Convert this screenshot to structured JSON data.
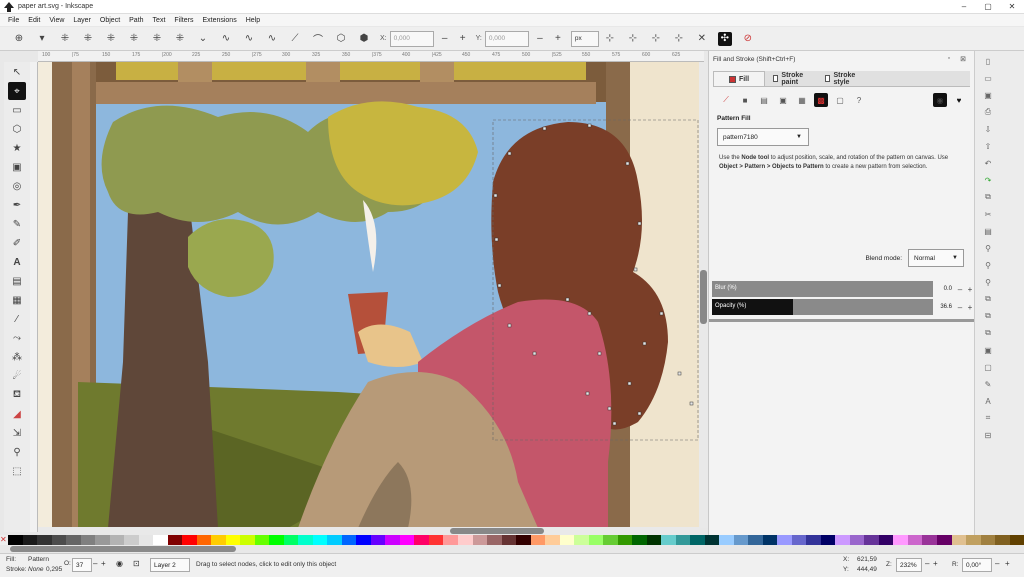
{
  "window": {
    "title": "paper art.svg - Inkscape",
    "controls": [
      "–",
      "▢",
      "✕"
    ]
  },
  "menu": [
    "File",
    "Edit",
    "View",
    "Layer",
    "Object",
    "Path",
    "Text",
    "Filters",
    "Extensions",
    "Help"
  ],
  "tool_controls": {
    "x_label": "X:",
    "x_value": "0,000",
    "y_label": "Y:",
    "y_value": "0,000",
    "unit": "px"
  },
  "ruler_ticks": [
    "100",
    "|75",
    "150",
    "175",
    "|200",
    "225",
    "250",
    "|275",
    "300",
    "325",
    "350",
    "|375",
    "400",
    "|425",
    "450",
    "475",
    "500",
    "|525",
    "550",
    "575",
    "600",
    "625"
  ],
  "dock": {
    "title": "Fill and Stroke (Shift+Ctrl+F)",
    "tabs": [
      "Fill",
      "Stroke paint",
      "Stroke style"
    ],
    "section_title": "Pattern Fill",
    "pattern_value": "pattern7180",
    "help_parts": [
      "Use the ",
      "Node tool",
      " to adjust position, scale, and rotation of the pattern on canvas. Use ",
      "Object > Pattern > Objects to Pattern",
      " to create a new pattern from selection."
    ],
    "blend_label": "Blend mode:",
    "blend_value": "Normal",
    "blur_label": "Blur (%)",
    "blur_value": "0.0",
    "blur_fraction": 0.0,
    "opacity_label": "Opacity (%)",
    "opacity_value": "36.6",
    "opacity_fraction": 0.366
  },
  "palette_colors": [
    "#000000",
    "#1a1a1a",
    "#333333",
    "#4d4d4d",
    "#666666",
    "#808080",
    "#999999",
    "#b3b3b3",
    "#cccccc",
    "#e6e6e6",
    "#ffffff",
    "#800000",
    "#ff0000",
    "#ff6600",
    "#ffcc00",
    "#ffff00",
    "#ccff00",
    "#66ff00",
    "#00ff00",
    "#00ff66",
    "#00ffcc",
    "#00ffff",
    "#00ccff",
    "#0066ff",
    "#0000ff",
    "#6600ff",
    "#cc00ff",
    "#ff00ff",
    "#ff0066",
    "#ff3333",
    "#ff9999",
    "#ffcccc",
    "#cc9999",
    "#996666",
    "#663333",
    "#330000",
    "#ff9966",
    "#ffcc99",
    "#ffffcc",
    "#ccff99",
    "#99ff66",
    "#66cc33",
    "#339900",
    "#006600",
    "#003300",
    "#66cccc",
    "#339999",
    "#006666",
    "#003333",
    "#99ccff",
    "#6699cc",
    "#336699",
    "#003366",
    "#9999ff",
    "#6666cc",
    "#333399",
    "#000066",
    "#cc99ff",
    "#9966cc",
    "#663399",
    "#330066",
    "#ff99ff",
    "#cc66cc",
    "#993399",
    "#660066",
    "#e0c090",
    "#c0a060",
    "#a08040",
    "#806020",
    "#604000"
  ],
  "status": {
    "fill_label": "Fill:",
    "fill_value": "Pattern",
    "stroke_label": "Stroke:",
    "stroke_value": "None",
    "stroke_width": "0,295",
    "o_label": "O:",
    "o_value": "37",
    "layer": "Layer 2",
    "message": "Drag to select nodes, click to edit only this object",
    "x_label": "X:",
    "x_value": "621,59",
    "y_label": "Y:",
    "y_value": "444,49",
    "z_label": "Z:",
    "zoom": "232%",
    "r_label": "R:",
    "rotation": "0,00°"
  }
}
